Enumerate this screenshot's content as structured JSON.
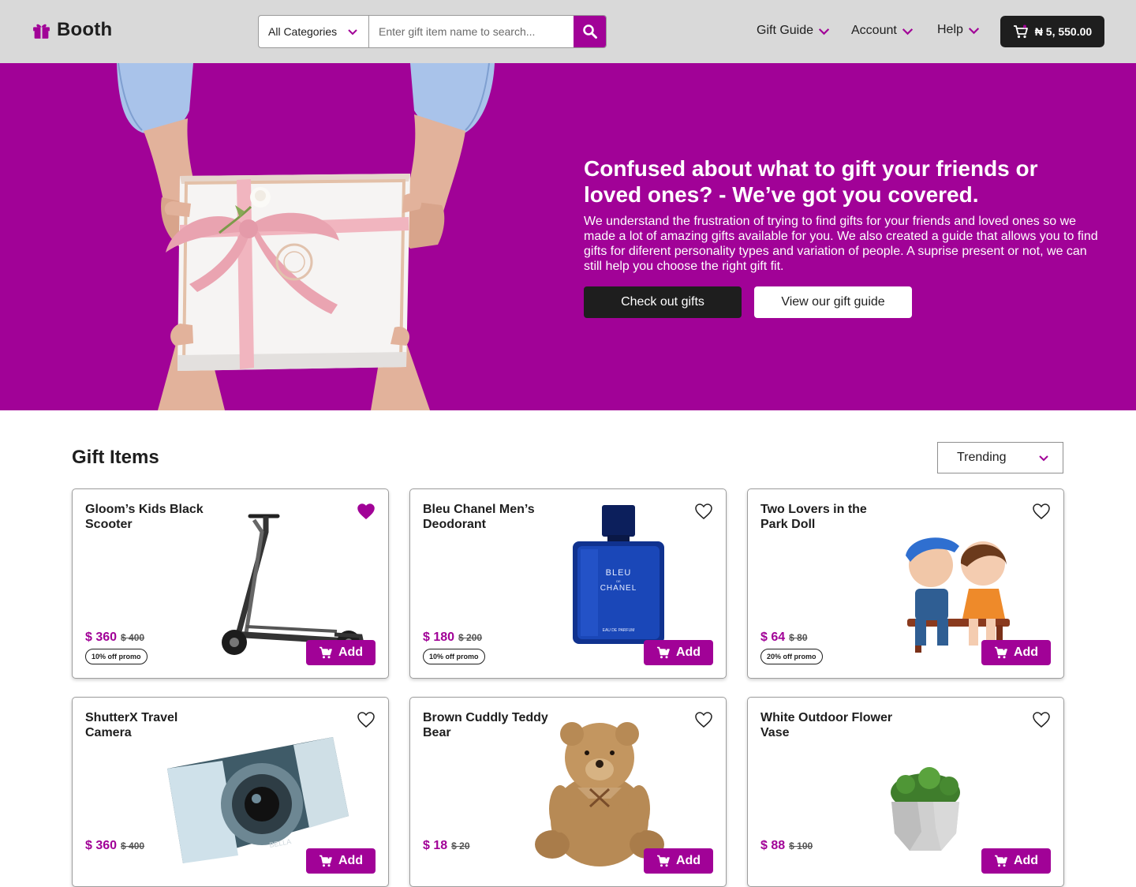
{
  "header": {
    "brand": "Booth",
    "search": {
      "category": "All Categories",
      "placeholder": "Enter gift item name to search..."
    },
    "nav": [
      {
        "label": "Gift Guide"
      },
      {
        "label": "Account"
      },
      {
        "label": "Help"
      }
    ],
    "cart_total": "₦ 5, 550.00"
  },
  "hero": {
    "title": "Confused about what to gift your friends or loved ones? - We’ve got you covered.",
    "text": "We understand the frustration of trying to find gifts for your friends and loved ones so we made a lot of amazing gifts available for you. We also created a guide that allows you to find gifts for diferent personality types and variation of people. A suprise present or not, we can still help you choose the right gift fit.",
    "primary_button": "Check out gifts",
    "secondary_button": "View our gift guide"
  },
  "products_section": {
    "title": "Gift Items",
    "sort_selected": "Trending",
    "add_label": "Add",
    "items": [
      {
        "title": "Gloom’s Kids Black Scooter",
        "price": "$ 360",
        "old_price": "$ 400",
        "promo": "10% off promo",
        "favorited": true
      },
      {
        "title": "Bleu Chanel Men’s Deodorant",
        "price": "$ 180",
        "old_price": "$ 200",
        "promo": "10% off promo",
        "favorited": false
      },
      {
        "title": "Two Lovers in the Park Doll",
        "price": "$ 64",
        "old_price": "$ 80",
        "promo": "20% off promo",
        "favorited": false
      },
      {
        "title": "ShutterX Travel Camera",
        "price": "$ 360",
        "old_price": "$ 400",
        "favorited": false
      },
      {
        "title": "Brown Cuddly Teddy Bear",
        "price": "$ 18",
        "old_price": "$ 20",
        "favorited": false
      },
      {
        "title": "White Outdoor Flower Vase",
        "price": "$ 88",
        "old_price": "$ 100",
        "favorited": false
      }
    ]
  },
  "product_image_text": {
    "perfume_brand": "BLEU",
    "perfume_de": "DE",
    "perfume_name": "CHANEL",
    "perfume_type": "EAU DE PARFUM",
    "camera_brand": "BELLA"
  },
  "colors": {
    "brand": "#a10297",
    "dark": "#1e1e1e",
    "header_bg": "#d9d9d9"
  },
  "icons": [
    "gift-icon",
    "chevron-down-icon",
    "search-icon",
    "cart-icon",
    "heart-icon",
    "add-to-cart-icon"
  ]
}
